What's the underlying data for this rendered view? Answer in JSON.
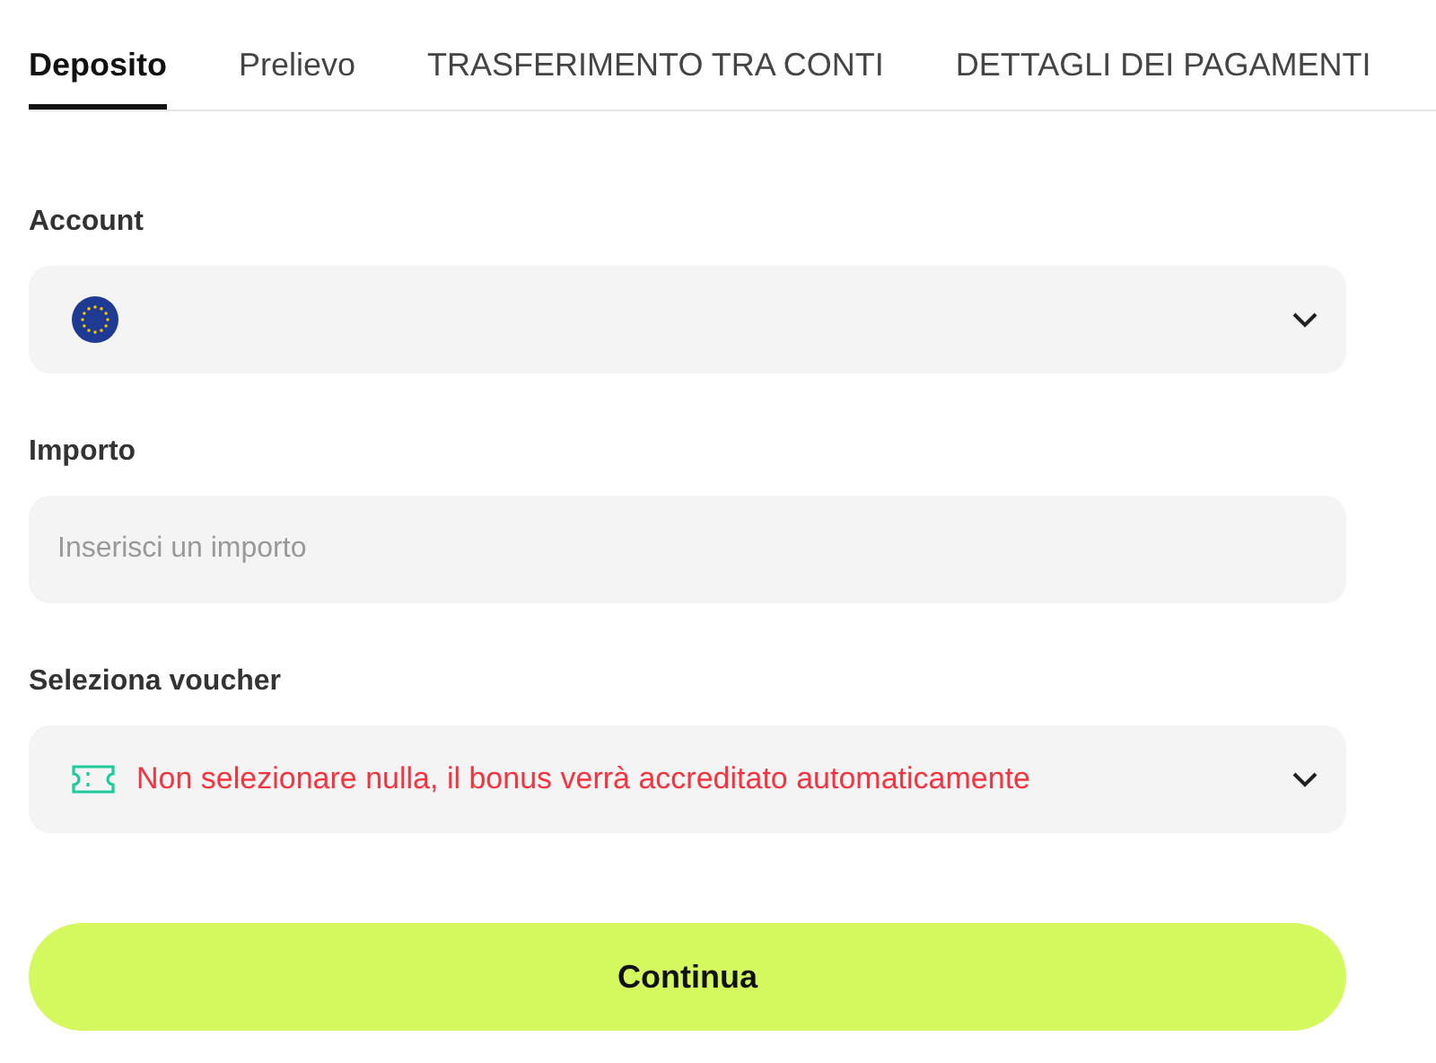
{
  "tabs": [
    {
      "label": "Deposito",
      "selected": true
    },
    {
      "label": "Prelievo",
      "selected": false
    },
    {
      "label": "TRASFERIMENTO TRA CONTI",
      "selected": false
    },
    {
      "label": "DETTAGLI DEI PAGAMENTI",
      "selected": false
    }
  ],
  "fields": [
    {
      "kind": "select",
      "label": "Account"
    },
    {
      "kind": "input",
      "label": "Importo",
      "placeholder": "Inserisci un importo"
    },
    {
      "kind": "select",
      "label": "Seleziona voucher",
      "value": "Non selezionare nulla, il bonus verrà accreditato automaticamente"
    }
  ],
  "submit": {
    "label": "Continua"
  }
}
